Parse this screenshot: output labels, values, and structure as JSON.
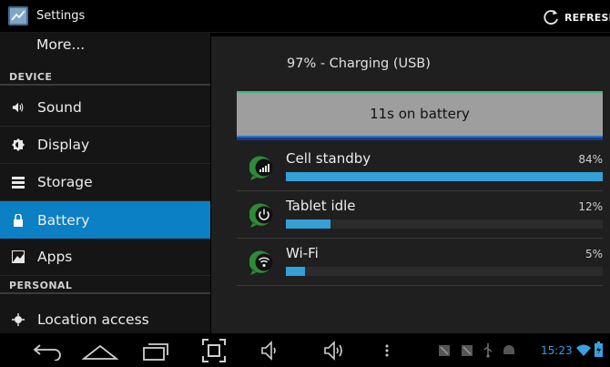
{
  "header": {
    "title": "Settings",
    "refresh_label": "REFRESH"
  },
  "sidebar": {
    "items": [
      {
        "label": "More...",
        "icon": "none"
      },
      {
        "label": "Sound",
        "icon": "speaker-icon"
      },
      {
        "label": "Display",
        "icon": "brightness-icon"
      },
      {
        "label": "Storage",
        "icon": "storage-icon"
      },
      {
        "label": "Battery",
        "icon": "lock-icon",
        "active": true
      },
      {
        "label": "Apps",
        "icon": "apps-icon"
      },
      {
        "label": "Location access",
        "icon": "location-icon"
      }
    ],
    "sections": {
      "device": "DEVICE",
      "personal": "PERSONAL"
    }
  },
  "battery": {
    "status": "97% - Charging (USB)",
    "graph_label": "11s on battery",
    "usage": [
      {
        "name": "Cell standby",
        "percent_label": "84%",
        "fraction": 1.0,
        "icon": "cell-signal-icon"
      },
      {
        "name": "Tablet idle",
        "percent_label": "12%",
        "fraction": 0.14,
        "icon": "power-icon"
      },
      {
        "name": "Wi-Fi",
        "percent_label": "5%",
        "fraction": 0.06,
        "icon": "wifi-icon"
      }
    ]
  },
  "navbar": {
    "time": "15:23"
  },
  "colors": {
    "accent": "#0b80c4",
    "bar": "#33a0d8",
    "graph": "#9e9e9e",
    "time": "#3aa0e0"
  }
}
